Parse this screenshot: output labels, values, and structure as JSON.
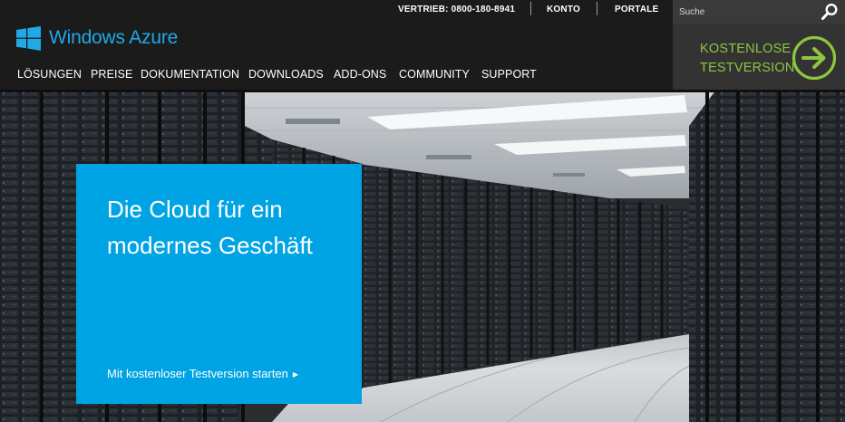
{
  "utility_nav": {
    "sales": "VERTRIEB: 0800-180-8941",
    "account": "KONTO",
    "portals": "PORTALE"
  },
  "search": {
    "placeholder": "Suche",
    "icon": "search-icon"
  },
  "brand": {
    "name": "Windows Azure",
    "icon": "windows-logo-icon",
    "color": "#1fa9e6"
  },
  "main_nav": {
    "items": [
      {
        "label": "LÖSUNGEN"
      },
      {
        "label": "PREISE"
      },
      {
        "label": "DOKUMENTATION"
      },
      {
        "label": "DOWNLOADS"
      },
      {
        "label": "ADD-ONS"
      },
      {
        "label": "COMMUNITY"
      },
      {
        "label": "SUPPORT"
      }
    ]
  },
  "trial": {
    "line1": "KOSTENLOSE",
    "line2": "TESTVERSION",
    "icon": "arrow-right-circle-icon",
    "color": "#8dc63f"
  },
  "hero": {
    "title_line1": "Die Cloud für ein",
    "title_line2": "modernes Geschäft",
    "cta_label": "Mit kostenloser Testversion starten",
    "cta_icon": "caret-right-icon",
    "box_color": "#00a4e4"
  }
}
